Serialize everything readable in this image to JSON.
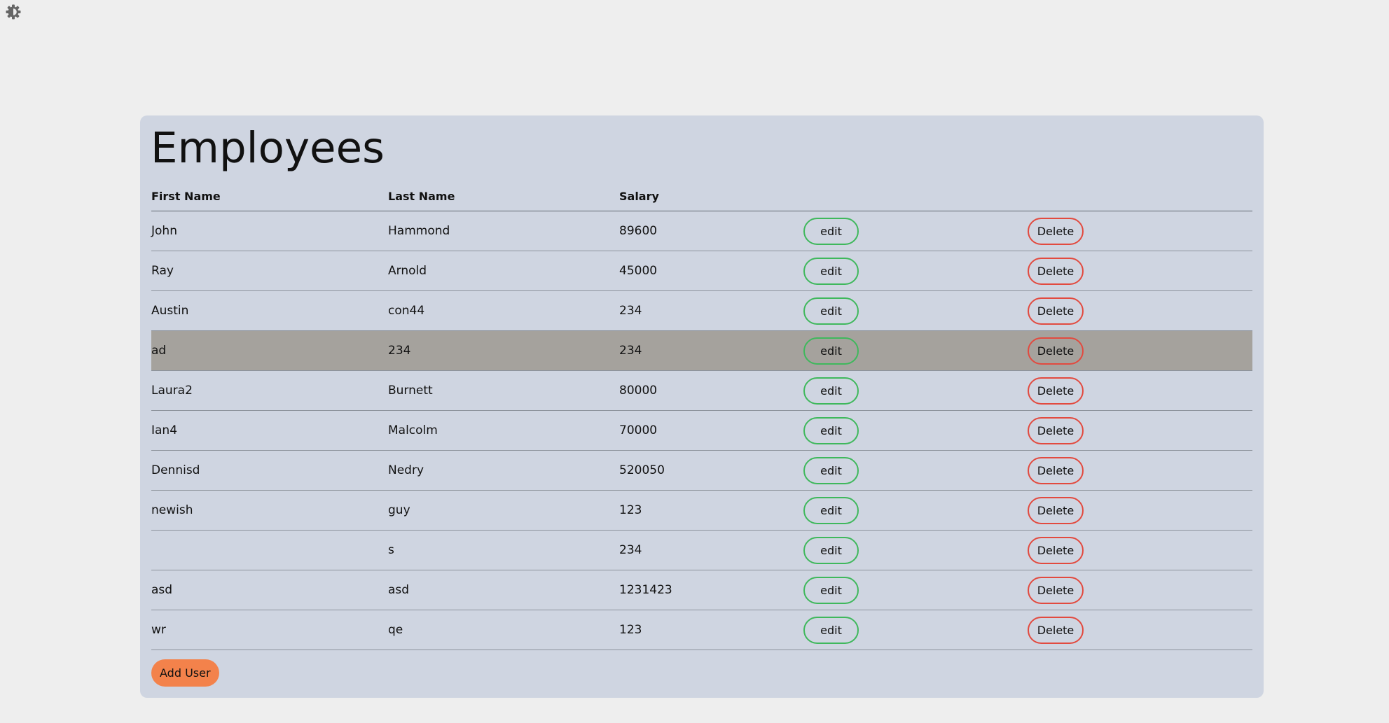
{
  "page": {
    "title": "Employees",
    "theme_toggle_icon": "contrast-gear-icon"
  },
  "table": {
    "headers": {
      "first_name": "First Name",
      "last_name": "Last Name",
      "salary": "Salary"
    },
    "rows": [
      {
        "first_name": "John",
        "last_name": "Hammond",
        "salary": "89600",
        "edit": "edit",
        "delete": "Delete",
        "highlighted": false
      },
      {
        "first_name": "Ray",
        "last_name": "Arnold",
        "salary": "45000",
        "edit": "edit",
        "delete": "Delete",
        "highlighted": false
      },
      {
        "first_name": "Austin",
        "last_name": "con44",
        "salary": "234",
        "edit": "edit",
        "delete": "Delete",
        "highlighted": false
      },
      {
        "first_name": "ad",
        "last_name": "234",
        "salary": "234",
        "edit": "edit",
        "delete": "Delete",
        "highlighted": true
      },
      {
        "first_name": "Laura2",
        "last_name": "Burnett",
        "salary": "80000",
        "edit": "edit",
        "delete": "Delete",
        "highlighted": false
      },
      {
        "first_name": "Ian4",
        "last_name": "Malcolm",
        "salary": "70000",
        "edit": "edit",
        "delete": "Delete",
        "highlighted": false
      },
      {
        "first_name": "Dennisd",
        "last_name": "Nedry",
        "salary": "520050",
        "edit": "edit",
        "delete": "Delete",
        "highlighted": false
      },
      {
        "first_name": "newish",
        "last_name": "guy",
        "salary": "123",
        "edit": "edit",
        "delete": "Delete",
        "highlighted": false
      },
      {
        "first_name": "",
        "last_name": "s",
        "salary": "234",
        "edit": "edit",
        "delete": "Delete",
        "highlighted": false
      },
      {
        "first_name": "asd",
        "last_name": "asd",
        "salary": "1231423",
        "edit": "edit",
        "delete": "Delete",
        "highlighted": false
      },
      {
        "first_name": "wr",
        "last_name": "qe",
        "salary": "123",
        "edit": "edit",
        "delete": "Delete",
        "highlighted": false
      }
    ]
  },
  "actions": {
    "add_user_label": "Add User"
  },
  "colors": {
    "page_background": "#eeeeee",
    "card_background": "#cfd5e1",
    "highlight_row": "#a5a29d",
    "edit_border": "#3fb85c",
    "delete_border": "#e24a3f",
    "add_button": "#f3824b"
  }
}
